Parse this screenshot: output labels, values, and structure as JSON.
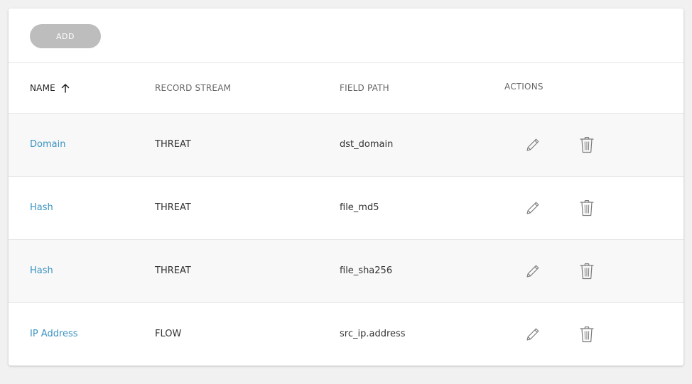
{
  "toolbar": {
    "add_label": "ADD"
  },
  "table": {
    "headers": {
      "name": "NAME",
      "record_stream": "RECORD STREAM",
      "field_path": "FIELD PATH",
      "actions": "ACTIONS"
    },
    "sort": {
      "column": "name",
      "direction": "ascending",
      "icon": "arrow-up-icon"
    },
    "rows": [
      {
        "name": "Domain",
        "record_stream": "THREAT",
        "field_path": "dst_domain"
      },
      {
        "name": "Hash",
        "record_stream": "THREAT",
        "field_path": "file_md5"
      },
      {
        "name": "Hash",
        "record_stream": "THREAT",
        "field_path": "file_sha256"
      },
      {
        "name": "IP Address",
        "record_stream": "FLOW",
        "field_path": "src_ip.address"
      }
    ],
    "row_actions": [
      {
        "icon": "pencil-icon"
      },
      {
        "icon": "trash-icon"
      }
    ]
  },
  "colors": {
    "link": "#3a93c2",
    "add_button_bg": "#bdbdbd",
    "alt_row_bg": "#f8f8f8"
  }
}
